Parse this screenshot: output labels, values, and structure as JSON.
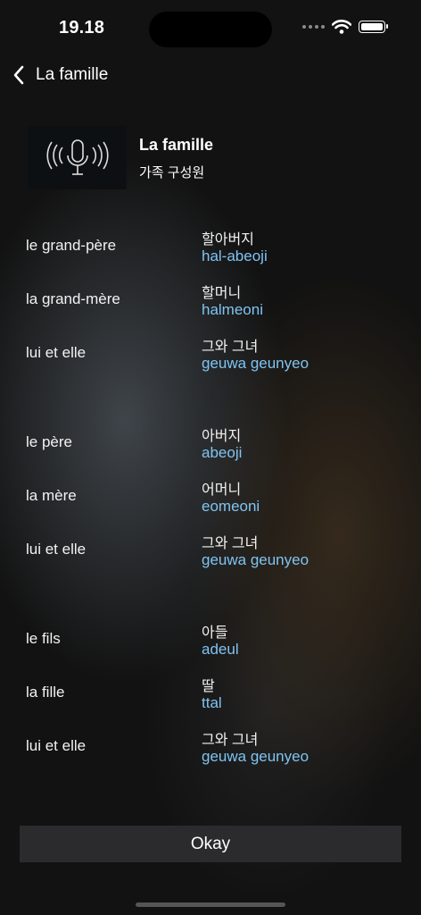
{
  "status_bar": {
    "time": "19.18"
  },
  "nav": {
    "back_label": "La famille"
  },
  "header": {
    "title": "La famille",
    "subtitle": "가족 구성원"
  },
  "vocab": [
    {
      "fr": "le grand-père",
      "ko": "할아버지",
      "rom": "hal-abeoji"
    },
    {
      "fr": "la grand-mère",
      "ko": "할머니",
      "rom": "halmeoni"
    },
    {
      "fr": "lui et elle",
      "ko": "그와 그녀",
      "rom": "geuwa geunyeo"
    },
    {
      "fr": "le père",
      "ko": "아버지",
      "rom": "abeoji"
    },
    {
      "fr": "la mère",
      "ko": "어머니",
      "rom": "eomeoni"
    },
    {
      "fr": "lui et elle",
      "ko": "그와 그녀",
      "rom": "geuwa geunyeo"
    },
    {
      "fr": "le fils",
      "ko": "아들",
      "rom": "adeul"
    },
    {
      "fr": "la fille",
      "ko": "딸",
      "rom": "ttal"
    },
    {
      "fr": "lui et elle",
      "ko": "그와 그녀",
      "rom": "geuwa geunyeo"
    }
  ],
  "button": {
    "okay_label": "Okay"
  }
}
